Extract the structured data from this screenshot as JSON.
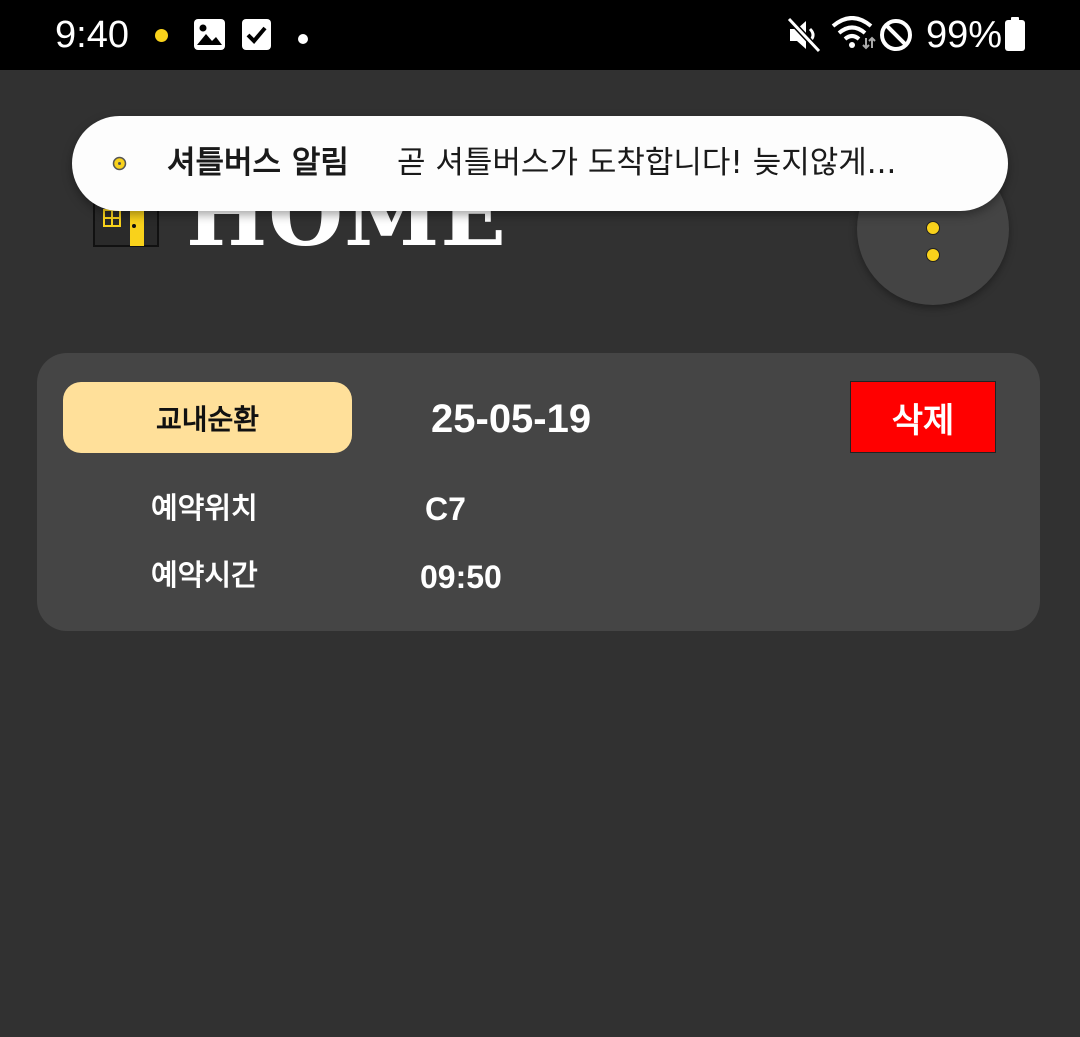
{
  "status_bar": {
    "time": "9:40",
    "battery": "99%",
    "icons": [
      "notification-dot-icon",
      "image-icon",
      "checkbox-icon",
      "more-dot-icon",
      "mute-icon",
      "wifi-icon",
      "do-not-disturb-icon",
      "battery-icon"
    ]
  },
  "colors": {
    "accent_yellow": "#f9d21b",
    "chip_background": "#ffe09a",
    "delete_red": "#ff0000",
    "background": "#313131",
    "card": "#454545"
  },
  "header": {
    "title": "HOME",
    "logo_icon": "door-icon",
    "menu_icon": "more-vertical-icon"
  },
  "notification": {
    "app_icon": "notification-dot-icon",
    "title": "셔틀버스 알림",
    "body": "곧 셔틀버스가 도착합니다! 늦지않게..."
  },
  "reservation": {
    "route": "교내순환",
    "date": "25-05-19",
    "delete_label": "삭제",
    "location_label": "예약위치",
    "location_value": "C7",
    "time_label": "예약시간",
    "time_value": "09:50"
  }
}
